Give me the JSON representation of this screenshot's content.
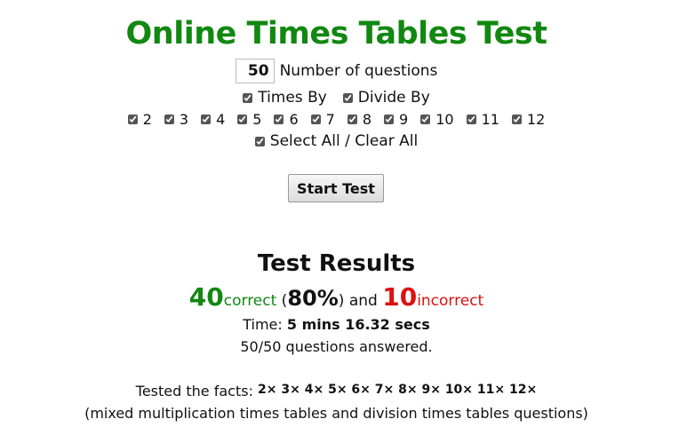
{
  "title": "Online Times Tables Test",
  "settings": {
    "num_questions_value": "50",
    "num_questions_label": "Number of questions",
    "operations": [
      {
        "label": "Times By",
        "checked": true
      },
      {
        "label": "Divide By",
        "checked": true
      }
    ],
    "tables": [
      {
        "label": "2",
        "checked": true
      },
      {
        "label": "3",
        "checked": true
      },
      {
        "label": "4",
        "checked": true
      },
      {
        "label": "5",
        "checked": true
      },
      {
        "label": "6",
        "checked": true
      },
      {
        "label": "7",
        "checked": true
      },
      {
        "label": "8",
        "checked": true
      },
      {
        "label": "9",
        "checked": true
      },
      {
        "label": "10",
        "checked": true
      },
      {
        "label": "11",
        "checked": true
      },
      {
        "label": "12",
        "checked": true
      }
    ],
    "select_all_label": "Select All / Clear All",
    "select_all_checked": true
  },
  "start_button_label": "Start Test",
  "results": {
    "heading": "Test Results",
    "correct_count": "40",
    "correct_word": "correct",
    "open_paren": " (",
    "percent": "80%",
    "and_text": ") and ",
    "incorrect_count": "10",
    "incorrect_word": "incorrect",
    "time_label": "Time: ",
    "time_value": "5 mins 16.32 secs",
    "answered": "50/50 questions answered.",
    "facts_label": "Tested the facts: ",
    "facts_value": "2× 3× 4× 5× 6× 7× 8× 9× 10× 11× 12×",
    "mixed_note": "(mixed multiplication times tables and division times tables questions)"
  },
  "colors": {
    "title_green": "#118811",
    "correct_green": "#118811",
    "incorrect_red": "#dd1111"
  }
}
